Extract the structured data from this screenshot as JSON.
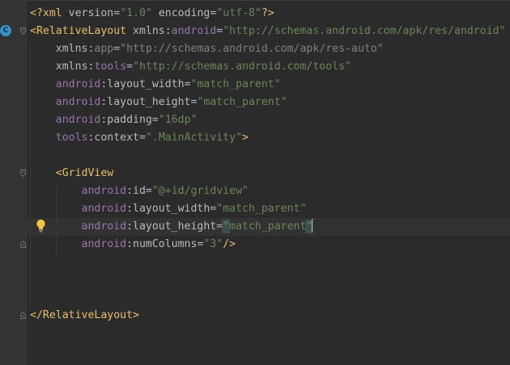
{
  "editor": {
    "gutter": {
      "class_marker_icon": "class-c-icon",
      "class_marker_letter": "C"
    },
    "lines": [
      [
        {
          "c": "t-tag",
          "t": "<?xml"
        },
        {
          "c": "t-attr",
          "t": " version"
        },
        {
          "c": "t-plain",
          "t": "="
        },
        {
          "c": "t-val",
          "t": "\"1.0\""
        },
        {
          "c": "t-attr",
          "t": " encoding"
        },
        {
          "c": "t-plain",
          "t": "="
        },
        {
          "c": "t-val",
          "t": "\"utf-8\""
        },
        {
          "c": "t-tag",
          "t": "?>"
        }
      ],
      [
        {
          "c": "t-tag",
          "t": "<RelativeLayout"
        },
        {
          "c": "t-attr",
          "t": " xmlns:"
        },
        {
          "c": "t-ns",
          "t": "android"
        },
        {
          "c": "t-plain",
          "t": "="
        },
        {
          "c": "t-val",
          "t": "\"http://schemas.android.com/apk/res/android\""
        }
      ],
      [
        {
          "c": "t-attr",
          "t": "    xmlns:"
        },
        {
          "c": "t-dim",
          "t": "app"
        },
        {
          "c": "t-plain",
          "t": "="
        },
        {
          "c": "t-dim",
          "t": "\"http://schemas.android.com/apk/res-auto\""
        }
      ],
      [
        {
          "c": "t-attr",
          "t": "    xmlns:"
        },
        {
          "c": "t-ns",
          "t": "tools"
        },
        {
          "c": "t-plain",
          "t": "="
        },
        {
          "c": "t-val",
          "t": "\"http://schemas.android.com/tools\""
        }
      ],
      [
        {
          "c": "t-ns",
          "t": "    android"
        },
        {
          "c": "t-attr",
          "t": ":layout_width"
        },
        {
          "c": "t-plain",
          "t": "="
        },
        {
          "c": "t-val",
          "t": "\"match_parent\""
        }
      ],
      [
        {
          "c": "t-ns",
          "t": "    android"
        },
        {
          "c": "t-attr",
          "t": ":layout_height"
        },
        {
          "c": "t-plain",
          "t": "="
        },
        {
          "c": "t-val",
          "t": "\"match_parent\""
        }
      ],
      [
        {
          "c": "t-ns",
          "t": "    android"
        },
        {
          "c": "t-attr",
          "t": ":padding"
        },
        {
          "c": "t-plain",
          "t": "="
        },
        {
          "c": "t-val",
          "t": "\"16dp\""
        }
      ],
      [
        {
          "c": "t-ns",
          "t": "    tools"
        },
        {
          "c": "t-attr",
          "t": ":context"
        },
        {
          "c": "t-plain",
          "t": "="
        },
        {
          "c": "t-val",
          "t": "\".MainActivity\""
        },
        {
          "c": "t-tag",
          "t": ">"
        }
      ],
      [],
      [
        {
          "c": "t-tag",
          "t": "    <GridView"
        }
      ],
      [
        {
          "c": "t-ns",
          "t": "        android"
        },
        {
          "c": "t-attr",
          "t": ":id"
        },
        {
          "c": "t-plain",
          "t": "="
        },
        {
          "c": "t-val",
          "t": "\"@+id/gridview\""
        }
      ],
      [
        {
          "c": "t-ns",
          "t": "        android"
        },
        {
          "c": "t-attr",
          "t": ":layout_width"
        },
        {
          "c": "t-plain",
          "t": "="
        },
        {
          "c": "t-val",
          "t": "\"match_parent\""
        }
      ],
      [
        {
          "c": "t-ns",
          "t": "        android"
        },
        {
          "c": "t-attr",
          "t": ":layout_height"
        },
        {
          "c": "t-plain",
          "t": "="
        },
        {
          "c": "t-val quote-hl",
          "t": "\""
        },
        {
          "c": "t-val",
          "t": "match_parent"
        },
        {
          "c": "t-val quote-hl",
          "t": "\""
        },
        {
          "c": "caret",
          "t": ""
        }
      ],
      [
        {
          "c": "t-ns",
          "t": "        android"
        },
        {
          "c": "t-attr",
          "t": ":numColumns"
        },
        {
          "c": "t-plain",
          "t": "="
        },
        {
          "c": "t-val",
          "t": "\"3\""
        },
        {
          "c": "t-tag",
          "t": "/>"
        }
      ],
      [],
      [],
      [],
      [
        {
          "c": "t-tag",
          "t": "</RelativeLayout>"
        }
      ]
    ]
  }
}
